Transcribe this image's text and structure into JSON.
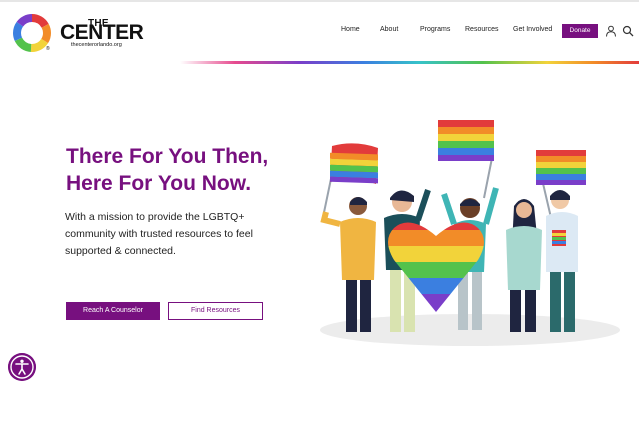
{
  "brand": {
    "the": "THE",
    "center": "CENTER",
    "url": "thecenterorlando.org",
    "registered": "®"
  },
  "nav": {
    "items": [
      {
        "label": "Home"
      },
      {
        "label": "About"
      },
      {
        "label": "Programs"
      },
      {
        "label": "Resources"
      },
      {
        "label": "Get Involved"
      }
    ],
    "donate_label": "Donate"
  },
  "icons": {
    "account": "user-icon",
    "search": "search-icon",
    "accessibility": "accessibility-icon"
  },
  "hero": {
    "title_line1": "There For You Then,",
    "title_line2": "Here For You Now.",
    "description": "With a mission to provide the LGBTQ+ community with trusted resources to feel supported & connected.",
    "primary_button": "Reach A Counselor",
    "secondary_button": "Find Resources"
  },
  "colors": {
    "brand_purple": "#77107f",
    "rainbow": [
      "#e23b3b",
      "#f28c28",
      "#f2d33a",
      "#53c24c",
      "#3b7fe0",
      "#7a3ec9"
    ]
  }
}
